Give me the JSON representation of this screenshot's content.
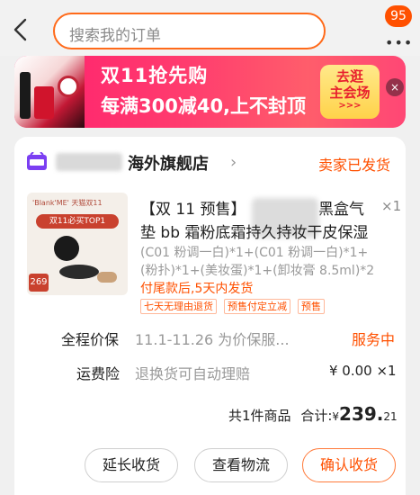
{
  "topbar": {
    "search_placeholder": "搜索我的订单",
    "more_badge": "95",
    "more_dots": "•••"
  },
  "banner": {
    "title": "双11抢先购",
    "subtitle": "每满300减40,上不封顶",
    "cta_line1": "去逛",
    "cta_line2": "主会场",
    "cta_arrows": ">>>",
    "close": "×"
  },
  "order": {
    "shop_name": "海外旗舰店",
    "status": "卖家已发货",
    "product": {
      "thumb_brand": "'Blank'ME' 天猫双11",
      "thumb_pill": "双11必买TOP1",
      "thumb_price": "269",
      "title_line1_a": "【双 11 预售】",
      "title_line1_b": "黑盒气",
      "title_line2": "垫 bb 霜粉底霜持久持妆干皮保湿",
      "quantity": "×1",
      "sku_line1": "(C01 粉调一白)*1+(C01  粉调一白)*1+",
      "sku_line2": "(粉扑)*1+(美妆蛋)*1+(卸妆膏 8.5ml)*2",
      "ship_note": "付尾款后,5天内发货",
      "tags": [
        "七天无理由退货",
        "预售付定立减",
        "预售"
      ]
    },
    "price_protect": {
      "label": "全程价保",
      "value": "11.1-11.26 为价保服...",
      "action": "服务中"
    },
    "insurance": {
      "label": "运费险",
      "value": "退换货可自动理赔",
      "price": "¥ 0.00 ×1"
    },
    "summary": {
      "count_text": "共1件商品",
      "total_label": "合计:",
      "currency": "¥",
      "total_int": "239.",
      "total_dec": "21"
    },
    "buttons": {
      "extend": "延长收货",
      "logistics": "查看物流",
      "confirm": "确认收货"
    }
  },
  "colors": {
    "accent": "#ff5000",
    "banner_pink": "#ff2d6e",
    "background": "#f0f0f0"
  }
}
